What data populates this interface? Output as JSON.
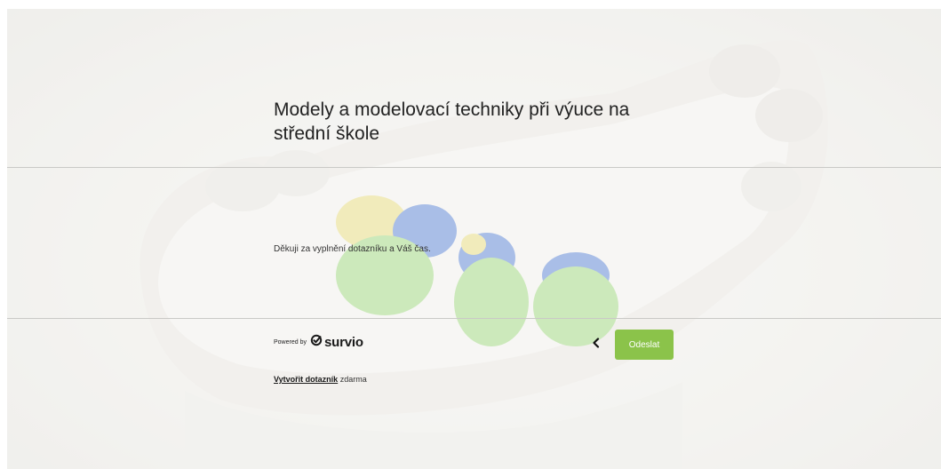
{
  "survey": {
    "title": "Modely a modelovací techniky při výuce na střední škole",
    "thank_you_message": "Děkuji za vyplnění dotazníku a Váš čas."
  },
  "footer": {
    "powered_by": "Powered by",
    "brand": "survio",
    "create_link": "Vytvořit dotazník",
    "create_suffix": " zdarma"
  },
  "navigation": {
    "back_icon": "chevron-left-icon",
    "submit_label": "Odeslat"
  },
  "colors": {
    "accent": "#8bc34a",
    "text": "#222222"
  },
  "background": {
    "description_icon": "dental-model-image"
  }
}
